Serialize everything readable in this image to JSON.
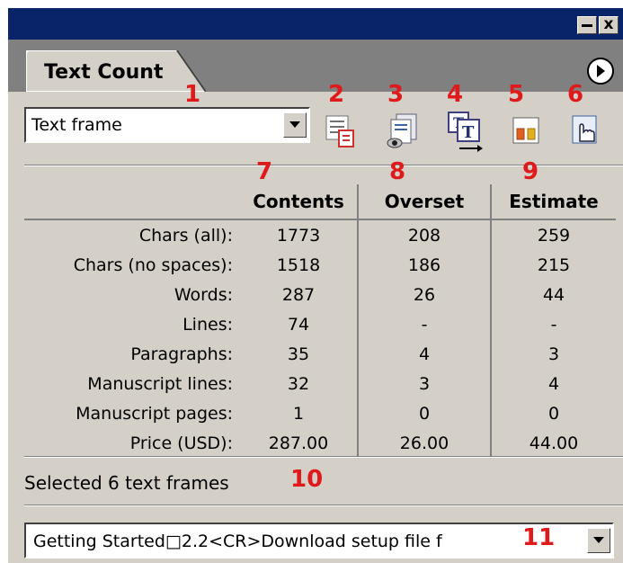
{
  "window": {
    "minimize_icon": "minimize-icon",
    "close_label": "x"
  },
  "tab": {
    "label": "Text Count"
  },
  "panel_menu_icon": "circle-arrow-right-icon",
  "mode_select": {
    "value": "Text frame"
  },
  "toolbar": {
    "tools": [
      {
        "icon": "text-list-icon"
      },
      {
        "icon": "preview-eye-icon"
      },
      {
        "icon": "text-flow-icon"
      },
      {
        "icon": "columns-icon"
      },
      {
        "icon": "hand-pointer-icon"
      }
    ]
  },
  "table": {
    "headers": [
      "Contents",
      "Overset",
      "Estimate"
    ],
    "rows": [
      {
        "label": "Chars (all):",
        "contents": "1773",
        "overset": "208",
        "estimate": "259"
      },
      {
        "label": "Chars (no spaces):",
        "contents": "1518",
        "overset": "186",
        "estimate": "215"
      },
      {
        "label": "Words:",
        "contents": "287",
        "overset": "26",
        "estimate": "44"
      },
      {
        "label": "Lines:",
        "contents": "74",
        "overset": "-",
        "estimate": "-"
      },
      {
        "label": "Paragraphs:",
        "contents": "35",
        "overset": "4",
        "estimate": "3"
      },
      {
        "label": "Manuscript lines:",
        "contents": "32",
        "overset": "3",
        "estimate": "4"
      },
      {
        "label": "Manuscript pages:",
        "contents": "1",
        "overset": "0",
        "estimate": "0"
      },
      {
        "label": "Price (USD):",
        "contents": "287.00",
        "overset": "26.00",
        "estimate": "44.00"
      }
    ]
  },
  "status": {
    "text": "Selected 6 text frames"
  },
  "paragraph_select": {
    "value": "Getting Started□2.2<CR>Download setup file f"
  },
  "annotations": [
    "1",
    "2",
    "3",
    "4",
    "5",
    "6",
    "7",
    "8",
    "9",
    "10",
    "11"
  ],
  "colors": {
    "title_bar": "#0a246a",
    "tab_strip": "#808080",
    "panel_bg": "#d4d0c8",
    "annotation": "#e0191b"
  }
}
